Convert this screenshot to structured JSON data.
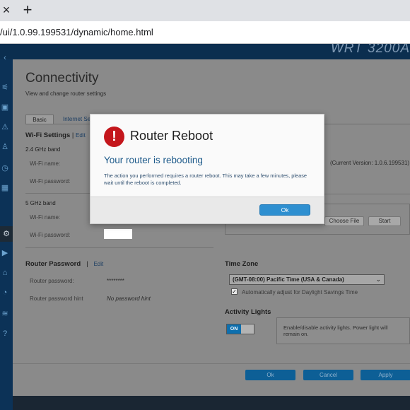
{
  "browser": {
    "tab_close": "×",
    "new_tab": "+",
    "url": "/ui/1.0.99.199531/dynamic/home.html"
  },
  "header": {
    "brand": "WRT 3200A"
  },
  "sidebar": {
    "icons": [
      "arrow-icon",
      "sliders-icon",
      "devices-icon",
      "warning-icon",
      "parental-icon",
      "clock-icon",
      "chart-icon",
      "gear-icon",
      "wireless-icon",
      "shield-icon",
      "speed-icon",
      "wifi-icon",
      "help-icon"
    ]
  },
  "page": {
    "title": "Connectivity",
    "subtitle": "View and change router settings",
    "tabs": [
      "Basic",
      "Internet Se"
    ]
  },
  "wifi": {
    "heading": "Wi-Fi Settings",
    "separator": "|",
    "edit": "Edit",
    "band24": "2.4 GHz band",
    "band5": "5 GHz band",
    "name_label": "Wi-Fi name:",
    "password_label": "Wi-Fi password:"
  },
  "firmware": {
    "current_version": "(Current Version: 1.0.6.199531)",
    "choose_file": "Choose File",
    "start": "Start"
  },
  "router_password": {
    "heading": "Router Password",
    "separator": "|",
    "edit": "Edit",
    "password_label": "Router password:",
    "password_value": "********",
    "hint_label": "Router password hint",
    "hint_value": "No password hint"
  },
  "time_zone": {
    "heading": "Time Zone",
    "selected": "(GMT-08:00) Pacific Time (USA & Canada)",
    "dst_checked": true,
    "dst_label": "Automatically adjust for Daylight Savings Time",
    "check_mark": "✓",
    "chevron": "⌄"
  },
  "activity_lights": {
    "heading": "Activity Lights",
    "toggle": "ON",
    "info": "Enable/disable activity lights. Power light will remain on."
  },
  "footer": {
    "ok": "Ok",
    "cancel": "Cancel",
    "apply": "Apply"
  },
  "modal": {
    "icon": "!",
    "title": "Router Reboot",
    "heading": "Your router is rebooting",
    "body": "The action you performed requires a router reboot. This may take a few minutes, please wait until the reboot is completed.",
    "ok": "Ok"
  },
  "colors": {
    "header_bg": "#0b2e4f",
    "overlay_bg": "#8a8a8a",
    "accent_blue": "#2e8fd0",
    "alert_red": "#c4161c",
    "heading_blue": "#1d5a8a"
  }
}
